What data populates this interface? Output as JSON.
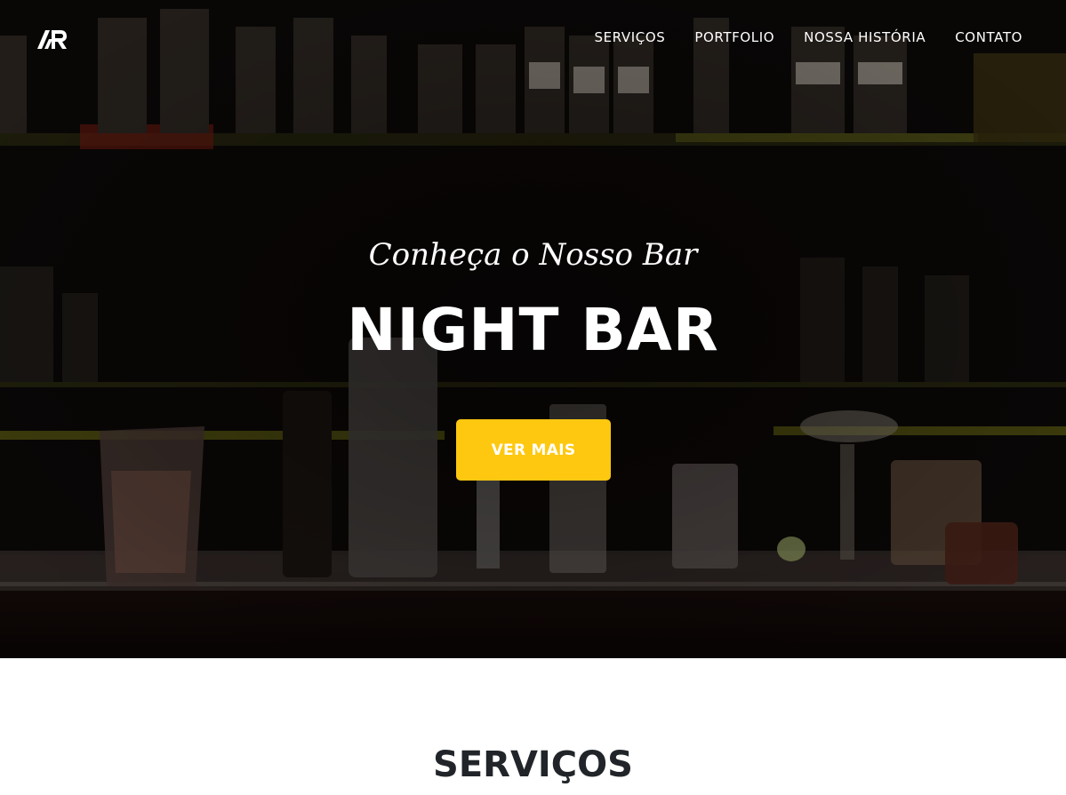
{
  "nav": {
    "logo_icon": "ar-monogram-logo",
    "links": [
      {
        "label": "SERVIÇOS"
      },
      {
        "label": "PORTFOLIO"
      },
      {
        "label": "NOSSA HISTÓRIA"
      },
      {
        "label": "CONTATO"
      }
    ]
  },
  "hero": {
    "subheading": "Conheça o Nosso Bar",
    "heading": "NIGHT BAR",
    "cta_label": "VER MAIS",
    "background_image": "dark bar counter with bottles on shelves and glassware",
    "accent_color": "#fec810"
  },
  "services": {
    "heading": "SERVIÇOS"
  }
}
